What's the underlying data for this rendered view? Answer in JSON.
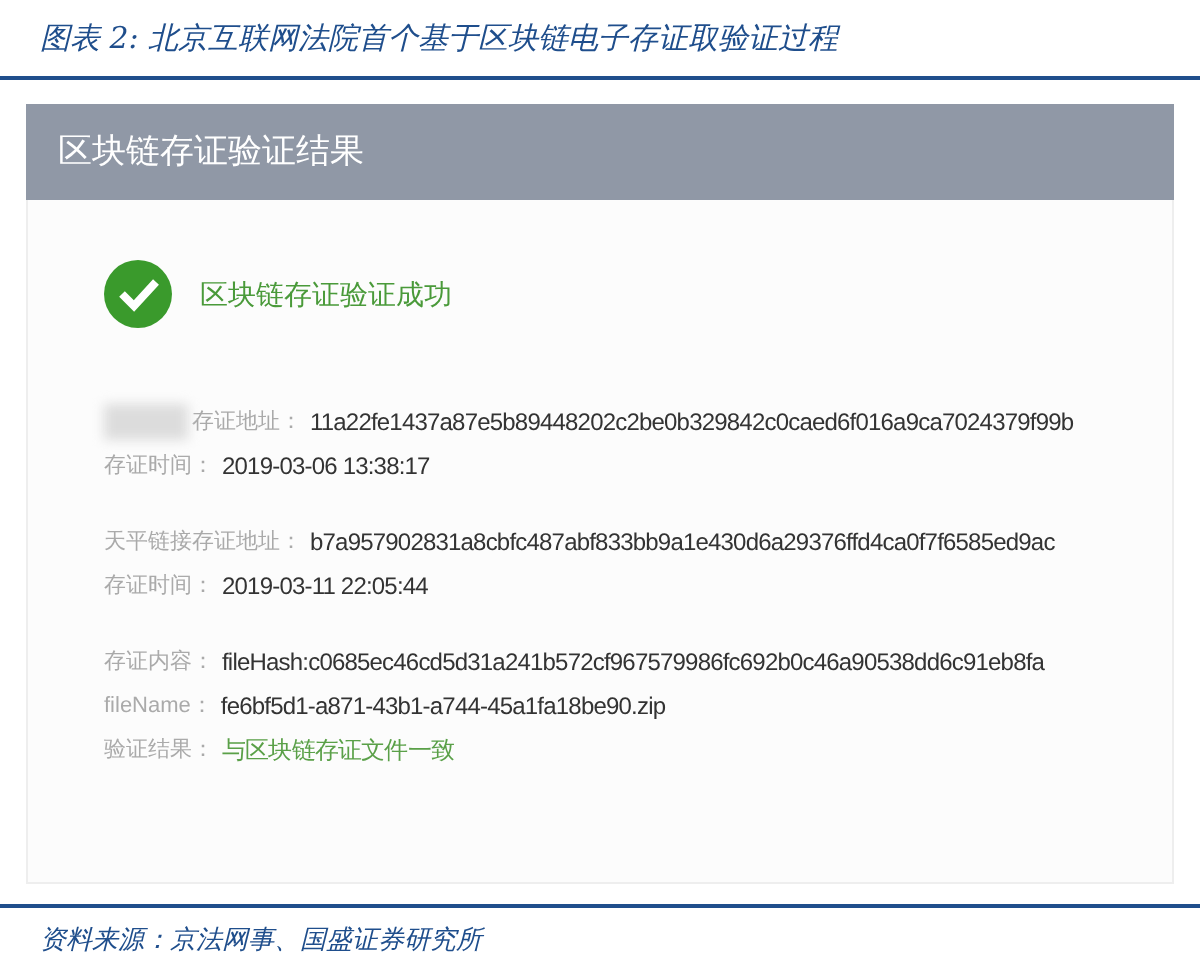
{
  "figure_title": "图表 2:  北京互联网法院首个基于区块链电子存证取验证过程",
  "panel": {
    "title": "区块链存证验证结果",
    "status": {
      "kind": "success",
      "text": "区块链存证验证成功"
    },
    "groups": [
      {
        "rows": [
          {
            "label": "存证地址：",
            "value": "11a22fe1437a87e5b89448202c2be0b329842c0caed6f016a9ca7024379f99b",
            "redacted": true
          },
          {
            "label": "存证时间：",
            "value": "2019-03-06 13:38:17",
            "redacted": false
          }
        ]
      },
      {
        "rows": [
          {
            "label": "天平链接存证地址：",
            "value": "b7a957902831a8cbfc487abf833bb9a1e430d6a29376ffd4ca0f7f6585ed9ac",
            "redacted": false
          },
          {
            "label": "存证时间：",
            "value": "2019-03-11 22:05:44",
            "redacted": false
          }
        ]
      },
      {
        "rows": [
          {
            "label": "存证内容：",
            "value": "fileHash:c0685ec46cd5d31a241b572cf967579986fc692b0c46a90538dd6c91eb8fa",
            "redacted": false
          },
          {
            "label": "fileName：",
            "value": "fe6bf5d1-a871-43b1-a744-45a1fa18be90.zip",
            "redacted": false
          },
          {
            "label": "验证结果：",
            "value": "与区块链存证文件一致",
            "redacted": false,
            "kind": "result"
          }
        ]
      }
    ]
  },
  "source": "资料来源：京法网事、国盛证券研究所"
}
